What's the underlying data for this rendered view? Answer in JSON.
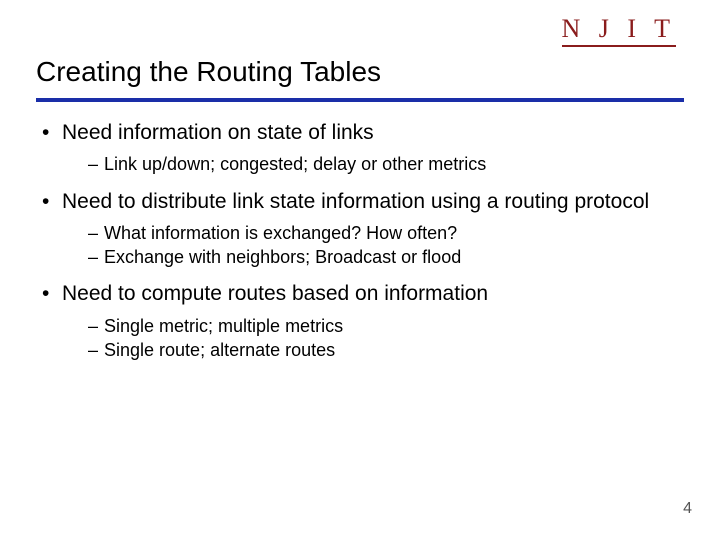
{
  "logo": {
    "text": "N J I T"
  },
  "title": "Creating the Routing Tables",
  "bullets": {
    "b0": {
      "text": "Need information on state of links",
      "sub": {
        "s0": "Link up/down; congested; delay or other metrics"
      }
    },
    "b1": {
      "text": "Need to distribute link state information using a routing protocol",
      "sub": {
        "s0": "What information is exchanged? How often?",
        "s1": "Exchange with neighbors; Broadcast or flood"
      }
    },
    "b2": {
      "text": "Need to compute routes based on information",
      "sub": {
        "s0": "Single metric;  multiple metrics",
        "s1": "Single route; alternate routes"
      }
    }
  },
  "page_number": "4"
}
